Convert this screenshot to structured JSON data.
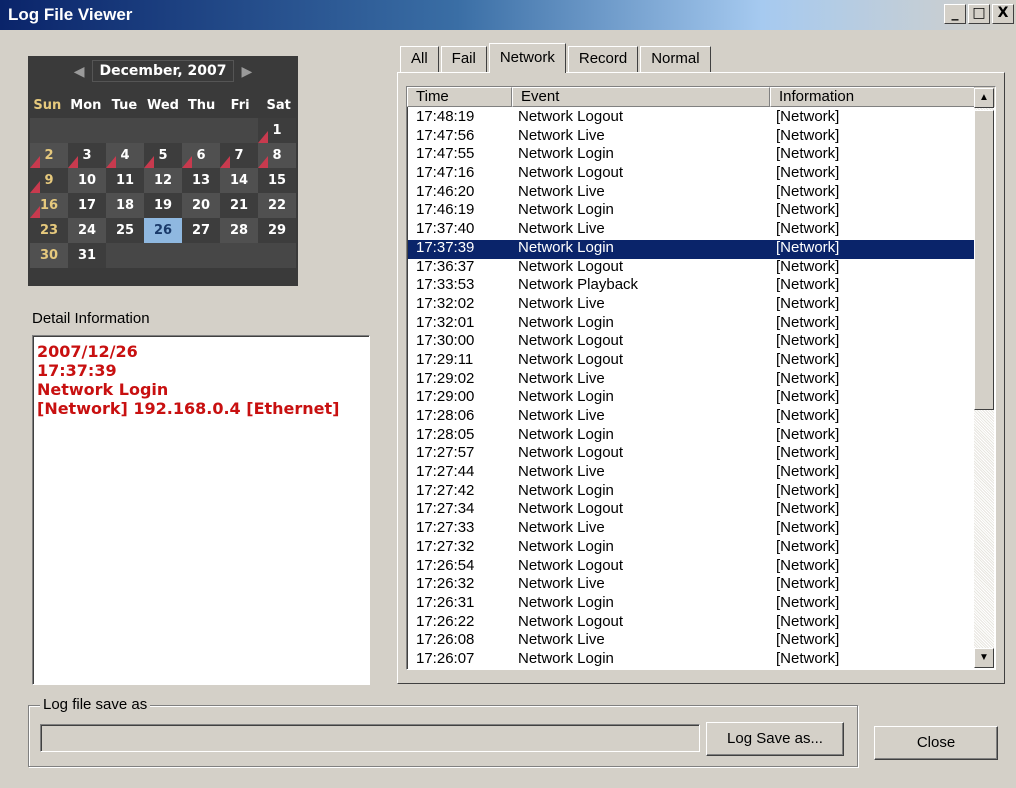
{
  "window": {
    "title": "Log File Viewer",
    "minimize": "_",
    "maximize": "□",
    "close": "X"
  },
  "calendar": {
    "month_label": "December, 2007",
    "prev": "◀",
    "next": "▶",
    "weekdays": [
      "Sun",
      "Mon",
      "Tue",
      "Wed",
      "Thu",
      "Fri",
      "Sat"
    ],
    "selected_day": "26",
    "days": [
      "",
      "",
      "",
      "",
      "",
      "",
      "1",
      "2",
      "3",
      "4",
      "5",
      "6",
      "7",
      "8",
      "9",
      "10",
      "11",
      "12",
      "13",
      "14",
      "15",
      "16",
      "17",
      "18",
      "19",
      "20",
      "21",
      "22",
      "23",
      "24",
      "25",
      "26",
      "27",
      "28",
      "29",
      "30",
      "31",
      "",
      "",
      "",
      "",
      ""
    ],
    "marked_days": [
      "1",
      "2",
      "3",
      "4",
      "5",
      "6",
      "7",
      "8",
      "9",
      "16"
    ]
  },
  "detail": {
    "label": "Detail Information",
    "lines": [
      "2007/12/26",
      "17:37:39",
      "Network Login",
      "[Network] 192.168.0.4 [Ethernet]"
    ]
  },
  "tabs": [
    {
      "label": "All",
      "active": false
    },
    {
      "label": "Fail",
      "active": false
    },
    {
      "label": "Network",
      "active": true
    },
    {
      "label": "Record",
      "active": false
    },
    {
      "label": "Normal",
      "active": false
    }
  ],
  "list": {
    "columns": [
      "Time",
      "Event",
      "Information"
    ],
    "selected_index": 7,
    "rows": [
      [
        "17:48:19",
        "Network Logout",
        "[Network]"
      ],
      [
        "17:47:56",
        "Network Live",
        "[Network]"
      ],
      [
        "17:47:55",
        "Network Login",
        "[Network]"
      ],
      [
        "17:47:16",
        "Network Logout",
        "[Network]"
      ],
      [
        "17:46:20",
        "Network Live",
        "[Network]"
      ],
      [
        "17:46:19",
        "Network Login",
        "[Network]"
      ],
      [
        "17:37:40",
        "Network Live",
        "[Network]"
      ],
      [
        "17:37:39",
        "Network Login",
        "[Network]"
      ],
      [
        "17:36:37",
        "Network Logout",
        "[Network]"
      ],
      [
        "17:33:53",
        "Network Playback",
        "[Network]"
      ],
      [
        "17:32:02",
        "Network Live",
        "[Network]"
      ],
      [
        "17:32:01",
        "Network Login",
        "[Network]"
      ],
      [
        "17:30:00",
        "Network Logout",
        "[Network]"
      ],
      [
        "17:29:11",
        "Network Logout",
        "[Network]"
      ],
      [
        "17:29:02",
        "Network Live",
        "[Network]"
      ],
      [
        "17:29:00",
        "Network Login",
        "[Network]"
      ],
      [
        "17:28:06",
        "Network Live",
        "[Network]"
      ],
      [
        "17:28:05",
        "Network Login",
        "[Network]"
      ],
      [
        "17:27:57",
        "Network Logout",
        "[Network]"
      ],
      [
        "17:27:44",
        "Network Live",
        "[Network]"
      ],
      [
        "17:27:42",
        "Network Login",
        "[Network]"
      ],
      [
        "17:27:34",
        "Network Logout",
        "[Network]"
      ],
      [
        "17:27:33",
        "Network Live",
        "[Network]"
      ],
      [
        "17:27:32",
        "Network Login",
        "[Network]"
      ],
      [
        "17:26:54",
        "Network Logout",
        "[Network]"
      ],
      [
        "17:26:32",
        "Network Live",
        "[Network]"
      ],
      [
        "17:26:31",
        "Network Login",
        "[Network]"
      ],
      [
        "17:26:22",
        "Network Logout",
        "[Network]"
      ],
      [
        "17:26:08",
        "Network Live",
        "[Network]"
      ],
      [
        "17:26:07",
        "Network Login",
        "[Network]"
      ]
    ],
    "scroll_up": "▲",
    "scroll_down": "▼"
  },
  "save": {
    "group_label": "Log file save as",
    "path_value": "",
    "save_button": "Log Save as...",
    "close_button": "Close"
  }
}
